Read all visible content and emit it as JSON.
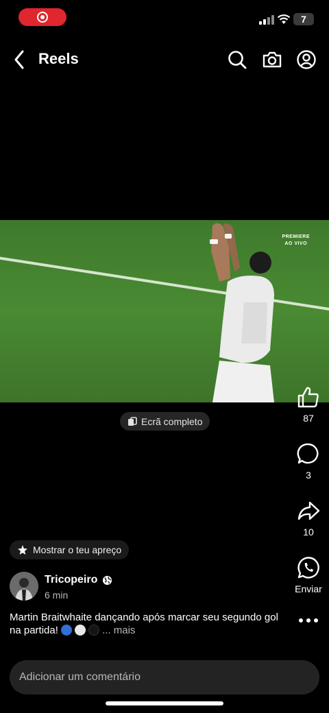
{
  "status_bar": {
    "battery": "7"
  },
  "header": {
    "back_icon": "chevron-left-icon",
    "title": "Reels",
    "icons": [
      "search-icon",
      "camera-icon",
      "profile-icon"
    ]
  },
  "video": {
    "broadcaster_line1": "PREMIERE",
    "broadcaster_line2": "AO VIVO",
    "fullscreen_label": "Ecrã completo"
  },
  "actions": {
    "like_count": "87",
    "comment_count": "3",
    "share_count": "10",
    "whatsapp_label": "Enviar"
  },
  "post": {
    "appreciation_label": "Mostrar o teu apreço",
    "author": "Tricopeiro",
    "time": "6 min",
    "caption": "Martin Braitwhaite dançando após marcar seu segundo gol na partida!",
    "caption_emojis": [
      "blue-circle",
      "white-circle",
      "black-circle"
    ],
    "caption_more": "... mais"
  },
  "comment_input": {
    "placeholder": "Adicionar um comentário"
  },
  "colors": {
    "record_red": "#e0262f",
    "background": "#000000",
    "pitch_green": "#4a8a33"
  }
}
